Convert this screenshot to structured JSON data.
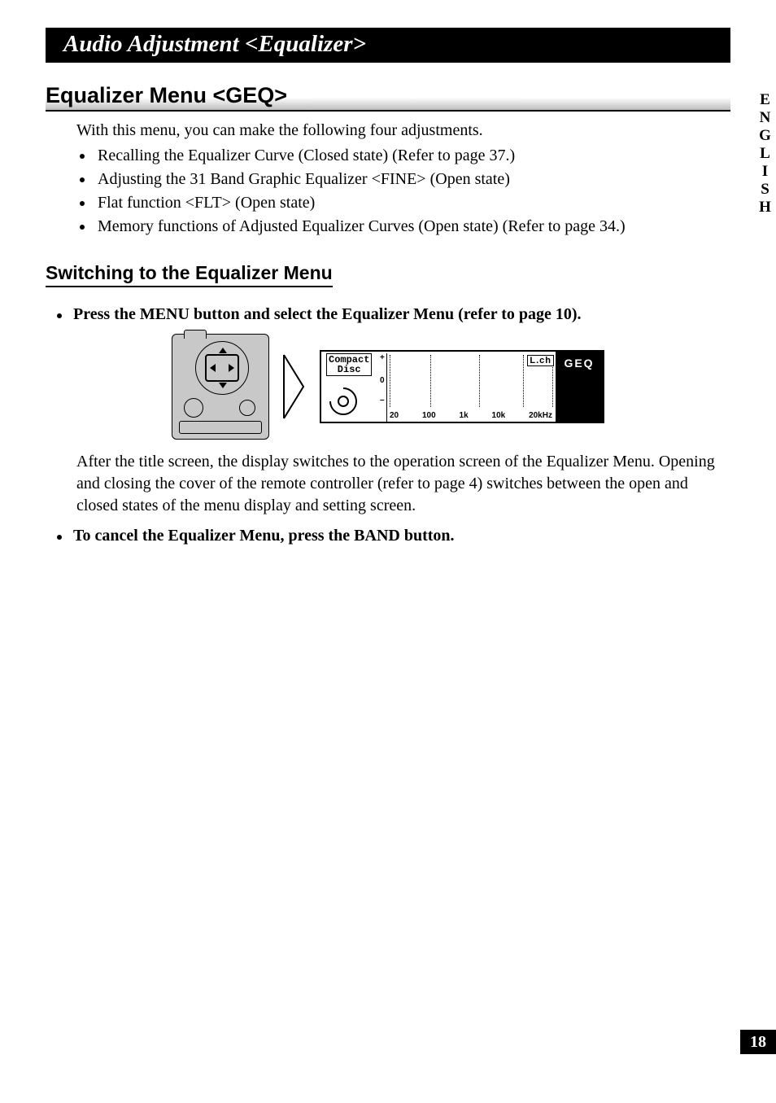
{
  "chapter_title": "Audio Adjustment <Equalizer>",
  "section_title": "Equalizer Menu <GEQ>",
  "intro": "With this menu, you can make the following four adjustments.",
  "bullets": [
    "Recalling the Equalizer Curve (Closed state) (Refer to page 37.)",
    "Adjusting the 31 Band Graphic Equalizer <FINE> (Open state)",
    "Flat function <FLT> (Open state)",
    "Memory functions of Adjusted Equalizer Curves (Open state) (Refer to page 34.)"
  ],
  "subsection_title": "Switching to the Equalizer Menu",
  "step1": "Press the MENU button and select the Equalizer Menu (refer to page 10).",
  "lcd": {
    "source_line1": "Compact",
    "source_line2": "Disc",
    "y_plus": "+",
    "y_zero": "0",
    "y_minus": "–",
    "x_ticks": [
      "20",
      "100",
      "1k",
      "10k",
      "20kHz"
    ],
    "channel": "L.ch",
    "mode": "GEQ"
  },
  "after_fig": "After the title screen, the display switches to the operation screen of the Equalizer Menu. Opening and closing the cover of the remote controller (refer to page 4) switches between the open and closed states of the menu display and setting screen.",
  "step2": "To cancel the Equalizer Menu, press the BAND button.",
  "language_tab": "ENGLISH",
  "page_number": "18"
}
